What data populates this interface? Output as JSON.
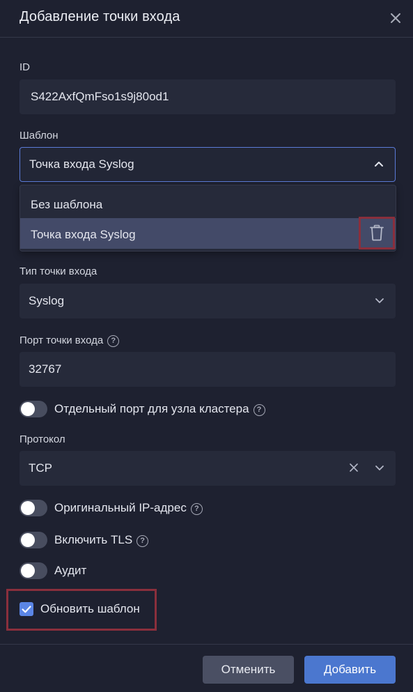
{
  "dialog": {
    "title": "Добавление точки входа"
  },
  "fields": {
    "id": {
      "label": "ID",
      "value": "S422AxfQmFso1s9j80od1"
    },
    "template": {
      "label": "Шаблон",
      "value": "Точка входа Syslog",
      "options": [
        "Без шаблона",
        "Точка входа Syslog"
      ]
    },
    "entry_type": {
      "label": "Тип точки входа",
      "value": "Syslog"
    },
    "port": {
      "label": "Порт точки входа",
      "value": "32767"
    },
    "separate_port": {
      "label": "Отдельный порт для узла кластера",
      "enabled": false
    },
    "protocol": {
      "label": "Протокол",
      "value": "TCP"
    },
    "original_ip": {
      "label": "Оригинальный IP-адрес",
      "enabled": false
    },
    "enable_tls": {
      "label": "Включить TLS",
      "enabled": false
    },
    "audit": {
      "label": "Аудит",
      "enabled": false
    },
    "update_template": {
      "label": "Обновить шаблон",
      "checked": true
    }
  },
  "buttons": {
    "cancel": "Отменить",
    "add": "Добавить"
  },
  "icons": {
    "help": "?"
  },
  "colors": {
    "background": "#1e2130",
    "field": "#262a3a",
    "accent": "#4b77cf",
    "highlight": "#8a2f3c"
  }
}
